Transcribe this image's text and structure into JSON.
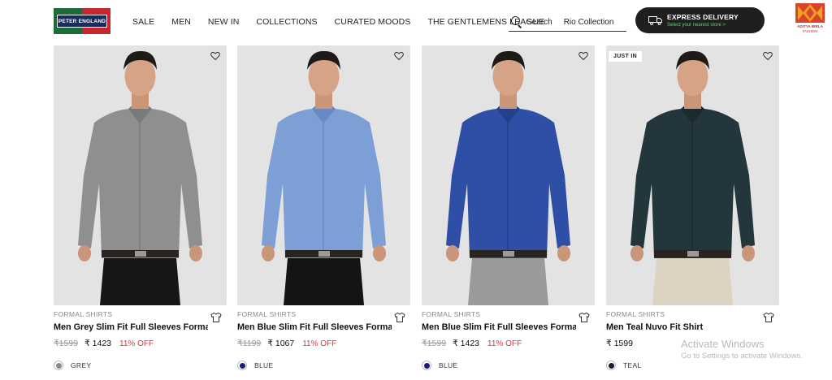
{
  "brand": {
    "logo_text": "PETER ENGLAND",
    "primary_color": "#1a2c5c"
  },
  "nav": {
    "items": [
      "SALE",
      "MEN",
      "NEW IN",
      "COLLECTIONS",
      "CURATED MOODS",
      "THE GENTLEMENS LEAGUE"
    ]
  },
  "search": {
    "label": "Search",
    "value": "Rio Collection",
    "icon": "search-icon"
  },
  "express": {
    "title": "EXPRESS DELIVERY",
    "subtitle": "Select your nearest store >",
    "icon": "truck-icon"
  },
  "group_logo": {
    "line1": "ADITYA BIRLA",
    "line2": "FASHION"
  },
  "products": [
    {
      "category": "FORMAL SHIRTS",
      "title": "Men Grey Slim Fit Full Sleeves Formal ...",
      "mrp": "₹1599",
      "price": "₹ 1423",
      "discount": "11% OFF",
      "color_name": "GREY",
      "swatch": "#8a8a8a",
      "shirt": "#8f8f8f",
      "shirt_shade": "#7a7a7a",
      "pants": "#161616",
      "badge": ""
    },
    {
      "category": "FORMAL SHIRTS",
      "title": "Men Blue Slim Fit Full Sleeves Formal ...",
      "mrp": "₹1199",
      "price": "₹ 1067",
      "discount": "11% OFF",
      "color_name": "BLUE",
      "swatch": "#1a1a7a",
      "shirt": "#7d9fd6",
      "shirt_shade": "#6889c4",
      "pants": "#141414",
      "badge": ""
    },
    {
      "category": "FORMAL SHIRTS",
      "title": "Men Blue Slim Fit Full Sleeves Formal ...",
      "mrp": "₹1599",
      "price": "₹ 1423",
      "discount": "11% OFF",
      "color_name": "BLUE",
      "swatch": "#1a1a7a",
      "shirt": "#2f4fa6",
      "shirt_shade": "#243f8c",
      "pants": "#9a9a9a",
      "badge": ""
    },
    {
      "category": "FORMAL SHIRTS",
      "title": "Men Teal Nuvo Fit Shirt",
      "mrp": "",
      "price": "₹ 1599",
      "discount": "",
      "color_name": "TEAL",
      "swatch": "#1a1a3a",
      "shirt": "#23363c",
      "shirt_shade": "#1a2a2f",
      "pants": "#ddd3c2",
      "badge": "JUST IN"
    }
  ],
  "watermark": {
    "title": "Activate Windows",
    "subtitle": "Go to Settings to activate Windows."
  }
}
